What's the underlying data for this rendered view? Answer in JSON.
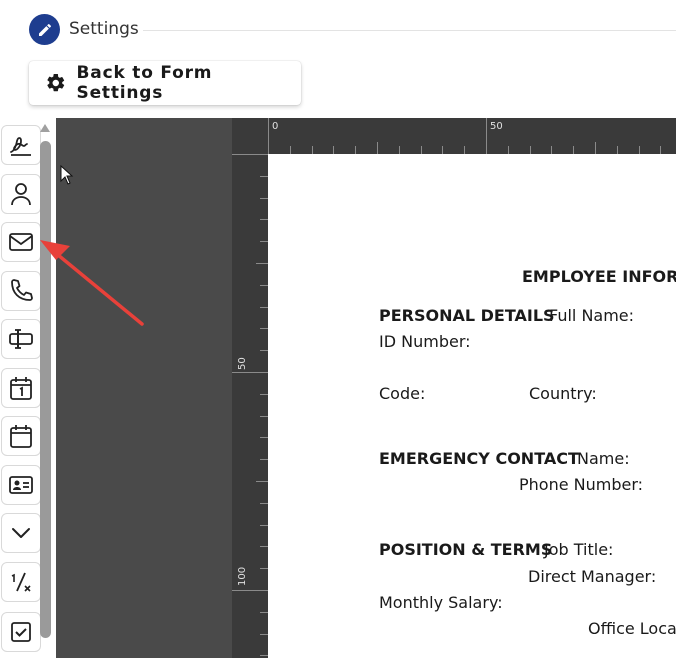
{
  "header": {
    "title": "Settings"
  },
  "back_button": {
    "label": "Back to Form Settings"
  },
  "toolbar": {
    "tools": [
      {
        "name": "signature"
      },
      {
        "name": "person"
      },
      {
        "name": "email"
      },
      {
        "name": "phone"
      },
      {
        "name": "text-field"
      },
      {
        "name": "date"
      },
      {
        "name": "calendar"
      },
      {
        "name": "id-card"
      },
      {
        "name": "dropdown"
      },
      {
        "name": "number"
      },
      {
        "name": "checkbox"
      }
    ]
  },
  "ruler": {
    "top": [
      "0",
      "50"
    ],
    "left": [
      "50",
      "100"
    ]
  },
  "document": {
    "heading": "EMPLOYEE INFORM",
    "personal_details": "PERSONAL DETAILS",
    "full_name": "Full Name:",
    "id_number": "ID Number:",
    "code": "Code:",
    "country": "Country:",
    "emergency_contact": "EMERGENCY CONTACT",
    "name": "Name:",
    "phone_number": "Phone Number:",
    "position_terms": "POSITION & TERMS",
    "job_title": "Job Title:",
    "direct_manager": "Direct Manager:",
    "monthly_salary": "Monthly Salary:",
    "office_location": "Office Loca"
  },
  "colors": {
    "accent": "#1e3d8f",
    "annotation_arrow": "#e8413a"
  }
}
